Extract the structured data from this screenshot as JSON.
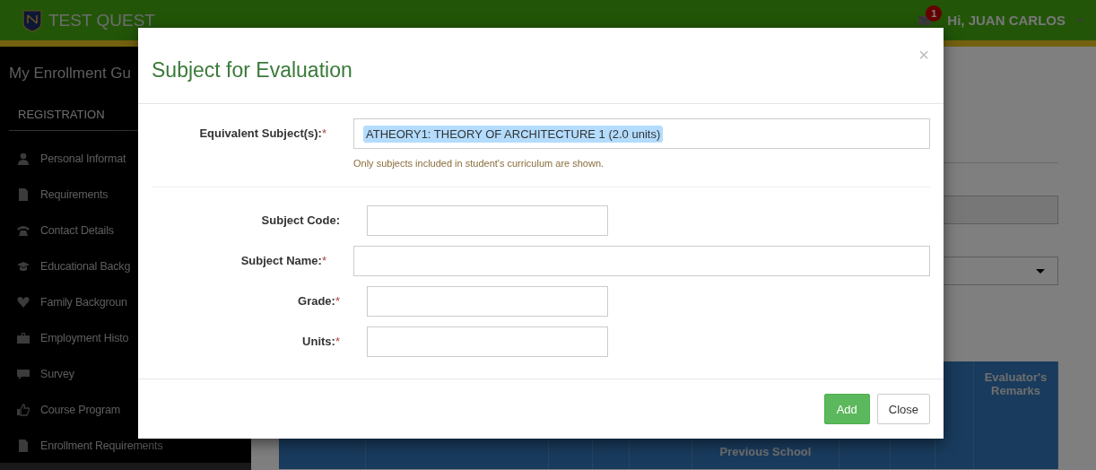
{
  "header": {
    "brand": "TEST QUEST",
    "notification_count": "1",
    "user": "Hi, JUAN CARLOS"
  },
  "sidebar": {
    "title": "My Enrollment Gu",
    "section": "REGISTRATION",
    "items": [
      {
        "label": "Personal Informat",
        "kind": "user"
      },
      {
        "label": "Requirements",
        "kind": "file"
      },
      {
        "label": "Contact Details",
        "kind": "phone"
      },
      {
        "label": "Educational Backg",
        "kind": "cap"
      },
      {
        "label": "Family Backgroun",
        "kind": "heart"
      },
      {
        "label": "Employment Histo",
        "kind": "briefcase"
      },
      {
        "label": "Survey",
        "kind": "comment"
      },
      {
        "label": "Course Program",
        "kind": "thumb"
      },
      {
        "label": "Enrollment Requirements",
        "kind": "file"
      }
    ]
  },
  "table": {
    "columns": [
      {
        "label": "Previous School"
      },
      {
        "label": "Evaluator's Remarks"
      }
    ]
  },
  "modal": {
    "title": "Subject for Evaluation",
    "close": "×",
    "fields": [
      {
        "kind": "select",
        "label": "Equivalent Subject(s):",
        "required_mark": "*",
        "wide": true,
        "value": "ATHEORY1: THEORY OF ARCHITECTURE 1 (2.0 units)",
        "hint": "Only subjects included in student's curriculum are shown."
      },
      {
        "kind": "text",
        "label": "Subject Code:",
        "wide": false
      },
      {
        "kind": "text",
        "label": "Subject Name:",
        "required_mark": "*",
        "wide": true
      },
      {
        "kind": "text",
        "label": "Grade:",
        "required_mark": "*",
        "wide": false
      },
      {
        "kind": "text",
        "label": "Units:",
        "required_mark": "*",
        "wide": false
      }
    ],
    "buttons": [
      {
        "label": "Add",
        "kind": "primary"
      },
      {
        "label": "Close",
        "kind": "default"
      }
    ]
  }
}
